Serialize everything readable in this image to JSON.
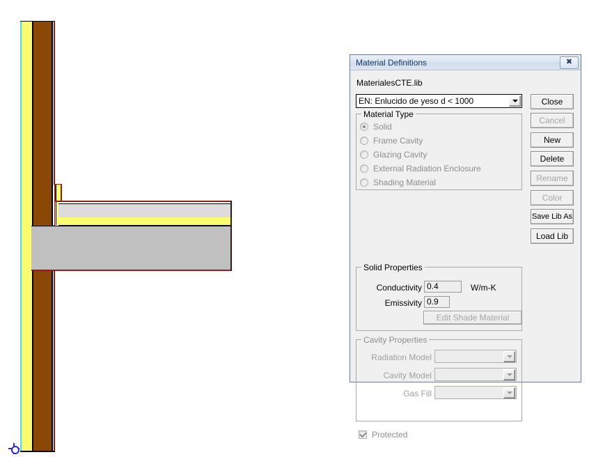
{
  "drawing": {
    "name": "wall-slab-thermal-bridge-section",
    "origin_marker": "origin-crosshair"
  },
  "dialog": {
    "title": "Material Definitions",
    "close_icon": "close-icon",
    "library_file": "MaterialesCTE.lib",
    "material_combo": {
      "value": "EN: Enlucido de yeso d < 1000",
      "arrow_icon": "chevron-down-icon"
    },
    "material_type": {
      "legend": "Material Type",
      "options": [
        {
          "label": "Solid",
          "selected": true
        },
        {
          "label": "Frame Cavity",
          "selected": false
        },
        {
          "label": "Glazing Cavity",
          "selected": false
        },
        {
          "label": "External Radiation Enclosure",
          "selected": false
        },
        {
          "label": "Shading Material",
          "selected": false
        }
      ]
    },
    "solid_properties": {
      "legend": "Solid Properties",
      "conductivity_label": "Conductivity",
      "conductivity_value": "0.4",
      "conductivity_unit": "W/m-K",
      "emissivity_label": "Emissivity",
      "emissivity_value": "0.9",
      "edit_shade_button": "Edit Shade Material"
    },
    "cavity_properties": {
      "legend": "Cavity Properties",
      "radiation_model_label": "Radiation Model",
      "radiation_model_value": "",
      "cavity_model_label": "Cavity Model",
      "cavity_model_value": "",
      "gas_fill_label": "Gas Fill",
      "gas_fill_value": ""
    },
    "protected": {
      "label": "Protected",
      "checked": true
    },
    "buttons": [
      {
        "label": "Close",
        "enabled": true
      },
      {
        "label": "Cancel",
        "enabled": false
      },
      {
        "label": "New",
        "enabled": true
      },
      {
        "label": "Delete",
        "enabled": true
      },
      {
        "label": "Rename",
        "enabled": false
      },
      {
        "label": "Color",
        "enabled": false
      },
      {
        "label": "Save Lib As",
        "enabled": true
      },
      {
        "label": "Load Lib",
        "enabled": true
      }
    ]
  },
  "colors": {
    "titlebar_text": "#16355c",
    "dialog_face": "#f0f0f0",
    "disabled_text": "#a6a6a6",
    "insulation_yellow": "#fbfb72",
    "wood_brown": "#8a4706",
    "concrete_gray": "#c0c0c0",
    "plaster_gray": "#dcdcdc",
    "boundary_red": "#9e1818",
    "boundary_cyan": "#4ee0d8"
  }
}
